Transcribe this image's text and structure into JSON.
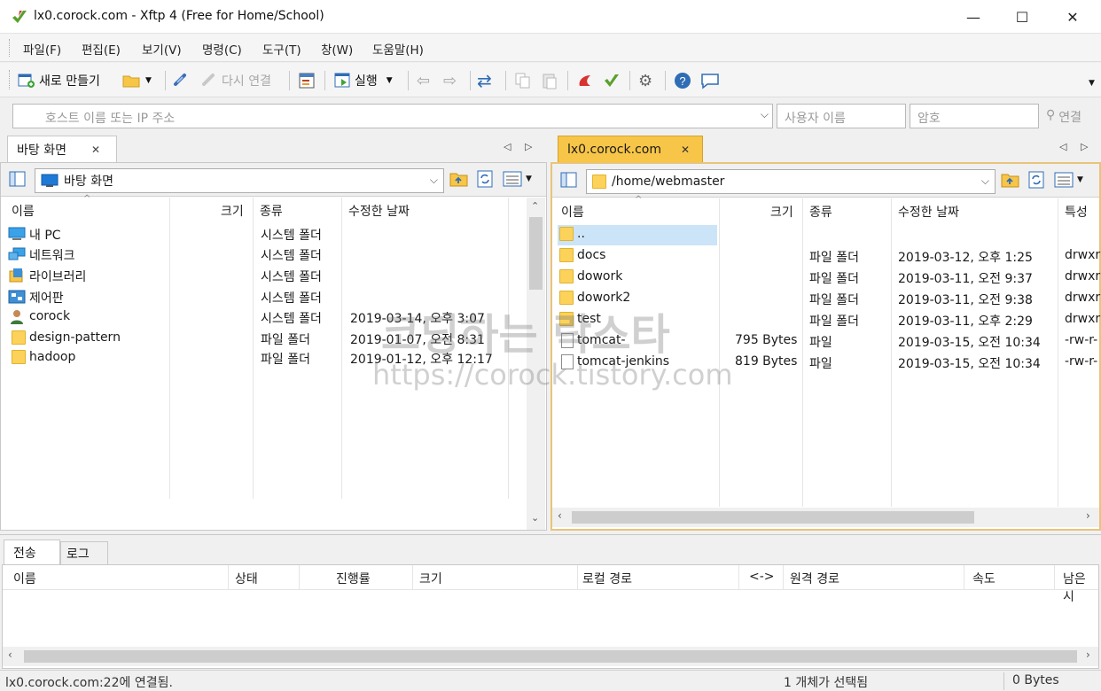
{
  "window": {
    "title": "lx0.corock.com - Xftp 4 (Free for Home/School)",
    "minimize": "—",
    "maximize": "☐",
    "close": "✕"
  },
  "menu": [
    "파일(F)",
    "편집(E)",
    "보기(V)",
    "명령(C)",
    "도구(T)",
    "창(W)",
    "도움말(H)"
  ],
  "toolbar": {
    "new_session": "새로 만들기",
    "reconnect": "다시 연결",
    "run": "실행"
  },
  "address": {
    "host_placeholder": "호스트 이름 또는 IP 주소",
    "user_placeholder": "사용자 이름",
    "password_placeholder": "암호",
    "connect": "연결"
  },
  "left_pane": {
    "tab": "바탕 화면",
    "path": "바탕 화면",
    "columns": {
      "name": "이름",
      "size": "크기",
      "type": "종류",
      "modified": "수정한 날짜"
    },
    "rows": [
      {
        "name": "내 PC",
        "size": "",
        "type": "시스템 폴더",
        "modified": "",
        "icon": "pc-icon"
      },
      {
        "name": "네트워크",
        "size": "",
        "type": "시스템 폴더",
        "modified": "",
        "icon": "network-icon"
      },
      {
        "name": "라이브러리",
        "size": "",
        "type": "시스템 폴더",
        "modified": "",
        "icon": "library-icon"
      },
      {
        "name": "제어판",
        "size": "",
        "type": "시스템 폴더",
        "modified": "",
        "icon": "control-panel-icon"
      },
      {
        "name": "corock",
        "size": "",
        "type": "시스템 폴더",
        "modified": "2019-03-14, 오후 3:07",
        "icon": "user-icon"
      },
      {
        "name": "design-pattern",
        "size": "",
        "type": "파일 폴더",
        "modified": "2019-01-07, 오전 8:31",
        "icon": "folder-icon"
      },
      {
        "name": "hadoop",
        "size": "",
        "type": "파일 폴더",
        "modified": "2019-01-12, 오후 12:17",
        "icon": "folder-icon"
      }
    ]
  },
  "right_pane": {
    "tab": "lx0.corock.com",
    "path": "/home/webmaster",
    "columns": {
      "name": "이름",
      "size": "크기",
      "type": "종류",
      "modified": "수정한 날짜",
      "attr": "특성"
    },
    "rows": [
      {
        "name": "..",
        "size": "",
        "type": "",
        "modified": "",
        "attr": "",
        "icon": "folder-icon"
      },
      {
        "name": "docs",
        "size": "",
        "type": "파일 폴더",
        "modified": "2019-03-12, 오후 1:25",
        "attr": "drwxr",
        "icon": "folder-icon"
      },
      {
        "name": "dowork",
        "size": "",
        "type": "파일 폴더",
        "modified": "2019-03-11, 오전 9:37",
        "attr": "drwxr",
        "icon": "folder-icon"
      },
      {
        "name": "dowork2",
        "size": "",
        "type": "파일 폴더",
        "modified": "2019-03-11, 오전 9:38",
        "attr": "drwxr",
        "icon": "folder-icon"
      },
      {
        "name": "test",
        "size": "",
        "type": "파일 폴더",
        "modified": "2019-03-11, 오후 2:29",
        "attr": "drwxr",
        "icon": "folder-icon"
      },
      {
        "name": "tomcat-",
        "size": "795 Bytes",
        "type": "파일",
        "modified": "2019-03-15, 오전 10:34",
        "attr": "-rw-r-",
        "icon": "file-icon"
      },
      {
        "name": "tomcat-jenkins",
        "size": "819 Bytes",
        "type": "파일",
        "modified": "2019-03-15, 오전 10:34",
        "attr": "-rw-r-",
        "icon": "file-icon"
      }
    ]
  },
  "transfer": {
    "tabs": [
      "전송",
      "로그"
    ],
    "columns": [
      "이름",
      "상태",
      "진행률",
      "크기",
      "로컬 경로",
      "<->",
      "원격 경로",
      "속도",
      "남은 시"
    ]
  },
  "status": {
    "left": "lx0.corock.com:22에 연결됨.",
    "middle": "1 개체가 선택됨",
    "right": "0 Bytes"
  },
  "watermark": {
    "line1": "코딩하는 락스타",
    "line2": "https://corock.tistory.com"
  }
}
